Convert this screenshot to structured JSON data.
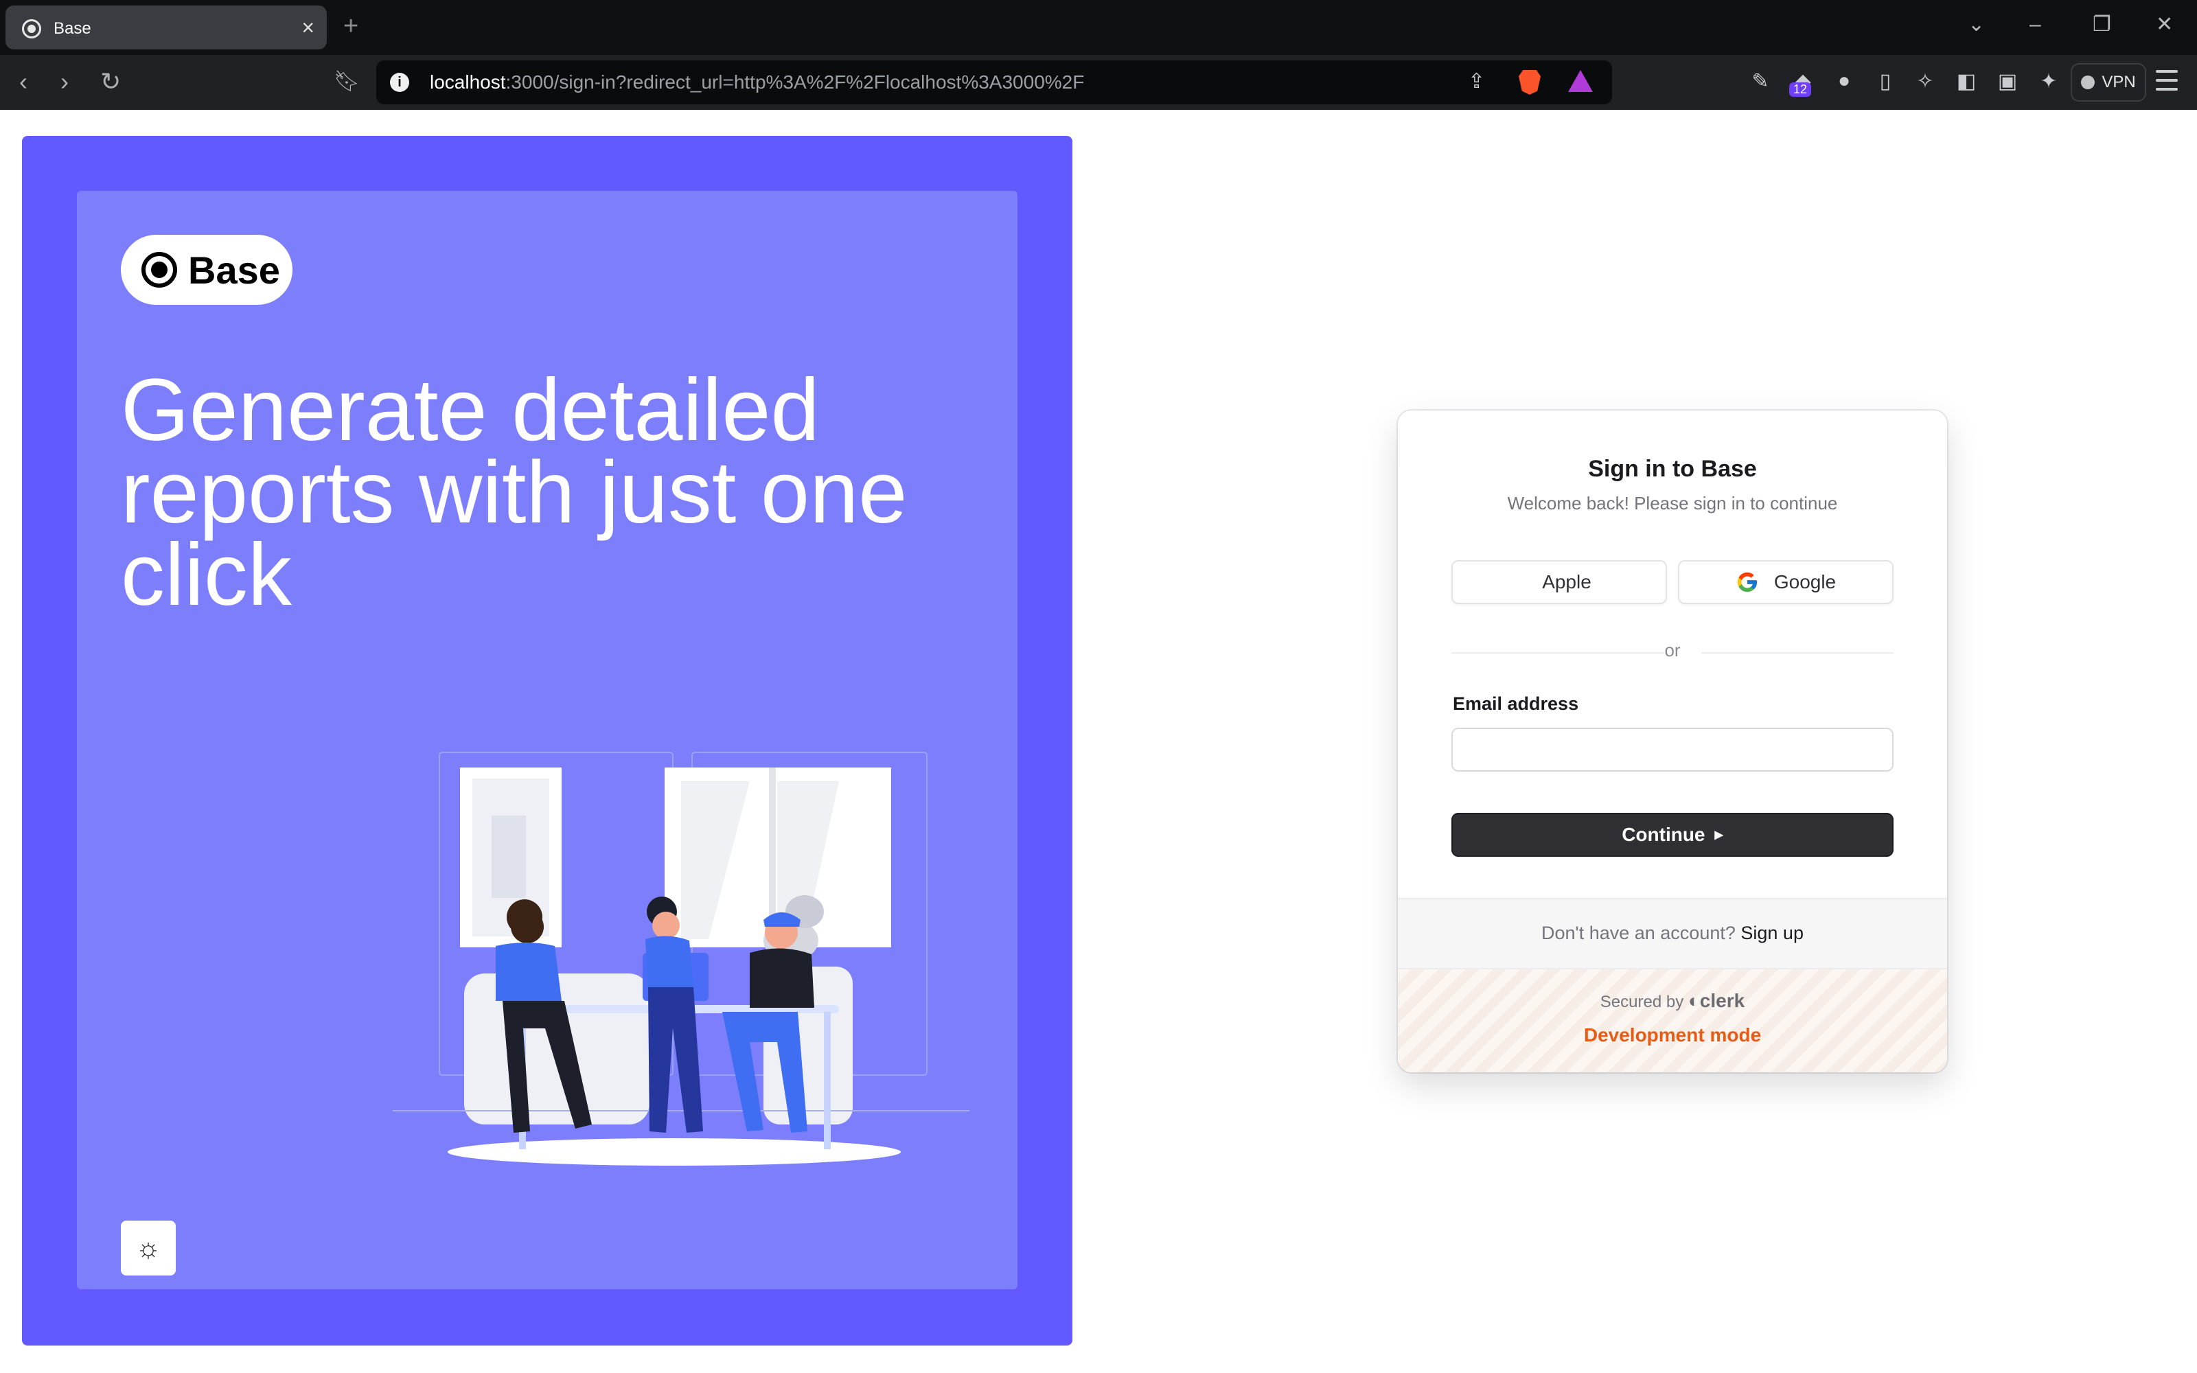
{
  "browser": {
    "tab_title": "Base",
    "tab_close": "×",
    "new_tab": "+",
    "url_host": "localhost",
    "url_rest": ":3000/sign-in?redirect_url=http%3A%2F%2Flocalhost%3A3000%2F",
    "extension_badge": "12",
    "vpn_label": "VPN"
  },
  "brand": {
    "logo_text": "Base",
    "headline": "Generate detailed reports with just one click"
  },
  "signin": {
    "title": "Sign in to Base",
    "subtitle": "Welcome back! Please sign in to continue",
    "apple_label": "Apple",
    "google_label": "Google",
    "divider_text": "or",
    "email_label": "Email address",
    "email_value": "",
    "continue_label": "Continue",
    "no_account_text": "Don't have an account?",
    "signup_link": "Sign up",
    "secured_by": "Secured by",
    "clerk": "clerk",
    "dev_mode": "Development mode"
  },
  "colors": {
    "panel_outer": "#6259ff",
    "panel_inner": "#7c7efb",
    "continue_bg": "#2f2f34",
    "dev_mode": "#e65c17"
  }
}
